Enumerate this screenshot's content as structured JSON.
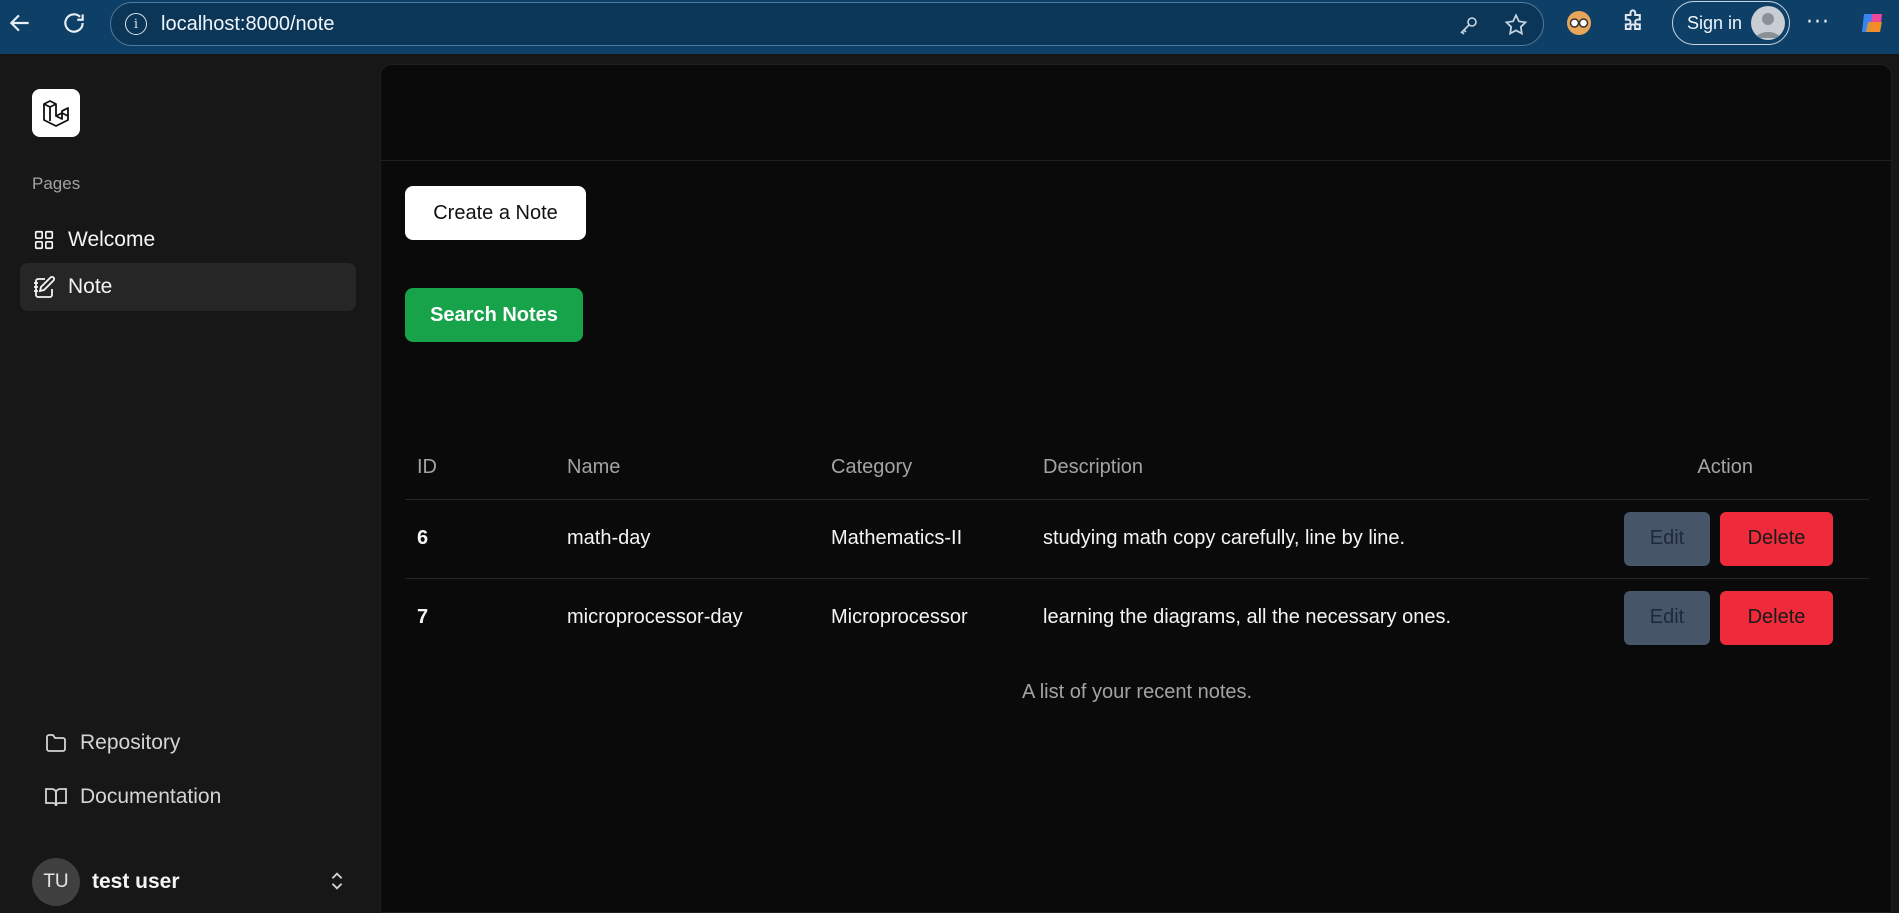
{
  "browser": {
    "url": "localhost:8000/note",
    "sign_in_label": "Sign in",
    "menu_dots": "···"
  },
  "sidebar": {
    "group_label": "Pages",
    "items": [
      {
        "label": "Welcome",
        "icon": "grid-icon"
      },
      {
        "label": "Note",
        "icon": "notebook-pen-icon",
        "active": true
      }
    ],
    "footer_links": [
      {
        "label": "Repository",
        "icon": "folder-icon"
      },
      {
        "label": "Documentation",
        "icon": "book-open-icon"
      }
    ],
    "user": {
      "initials": "TU",
      "name": "test user"
    }
  },
  "main": {
    "create_button": "Create a Note",
    "search_button": "Search Notes",
    "table": {
      "headers": [
        "ID",
        "Name",
        "Category",
        "Description",
        "Action"
      ],
      "rows": [
        {
          "id": "6",
          "name": "math-day",
          "category": "Mathematics-II",
          "description": "studying math copy carefully, line by line.",
          "edit": "Edit",
          "delete": "Delete"
        },
        {
          "id": "7",
          "name": "microprocessor-day",
          "category": "Microprocessor",
          "description": "learning the diagrams, all the necessary ones.",
          "edit": "Edit",
          "delete": "Delete"
        }
      ],
      "caption": "A list of your recent notes."
    }
  },
  "colors": {
    "chrome": "#0e3f66",
    "sidebar": "#171717",
    "main": "#0a0a0a",
    "search_button": "#16a34a",
    "edit_button": "#475569",
    "delete_button": "#ef2b3b"
  }
}
